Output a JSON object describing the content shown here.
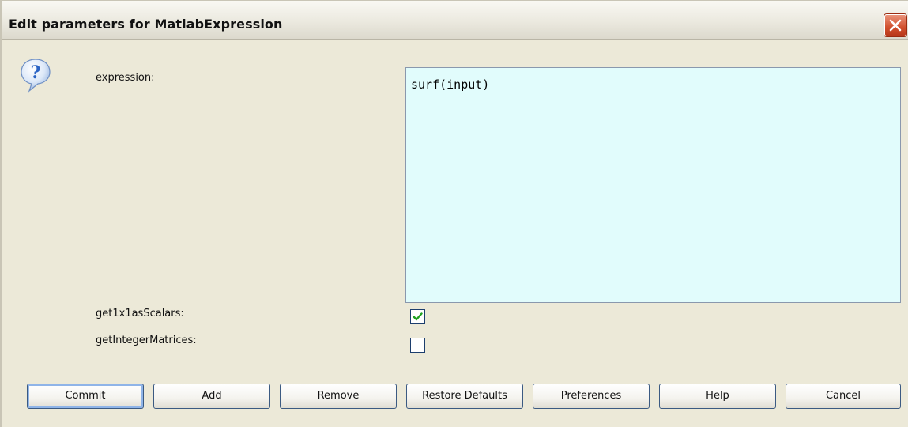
{
  "window": {
    "title": "Edit parameters for MatlabExpression"
  },
  "icons": {
    "help": "question-mark-icon",
    "close": "close-x-icon",
    "check": "checkmark-icon"
  },
  "params": {
    "expression_label": "expression:",
    "expression_value": "surf(input)",
    "get1x1_label": "get1x1asScalars:",
    "get1x1_checked": true,
    "getInteger_label": "getIntegerMatrices:",
    "getInteger_checked": false
  },
  "buttons": {
    "commit": "Commit",
    "add": "Add",
    "remove": "Remove",
    "restore": "Restore Defaults",
    "preferences": "Preferences",
    "help": "Help",
    "cancel": "Cancel"
  },
  "colors": {
    "expression_bg": "#e1fcfc",
    "close_button": "#d1502e",
    "check_mark": "#21a121",
    "help_icon": "#2a63c4"
  }
}
